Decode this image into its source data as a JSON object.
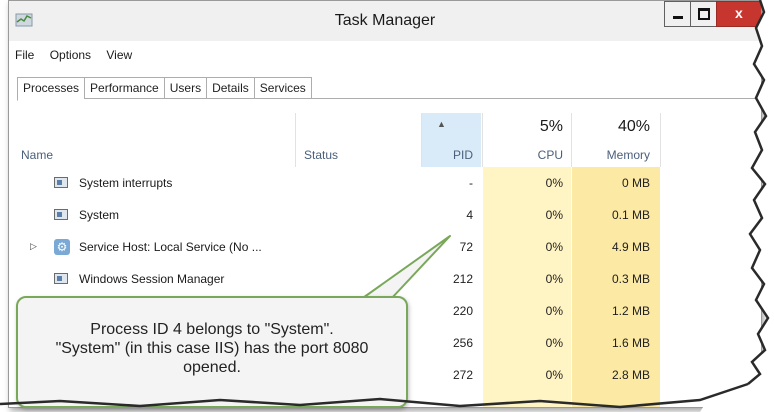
{
  "window": {
    "title": "Task Manager",
    "minimize_icon": "minimize-icon",
    "maximize_icon": "maximize-icon",
    "close_glyph": "x"
  },
  "menu": [
    "File",
    "Options",
    "View"
  ],
  "tabs": [
    "Processes",
    "Performance",
    "Users",
    "Details",
    "Services"
  ],
  "active_tab": "Processes",
  "columns": {
    "name": "Name",
    "status": "Status",
    "pid": "PID",
    "cpu": "CPU",
    "cpu_total": "5%",
    "memory": "Memory",
    "memory_total": "40%",
    "sort_indicator": "▲"
  },
  "rows": [
    {
      "name": "System interrupts",
      "status": "",
      "pid": "-",
      "cpu": "0%",
      "memory": "0 MB",
      "icon": "window-icon"
    },
    {
      "name": "System",
      "status": "",
      "pid": "4",
      "cpu": "0%",
      "memory": "0.1 MB",
      "icon": "window-icon"
    },
    {
      "name": "Service Host: Local Service (No ...",
      "status": "",
      "pid": "72",
      "cpu": "0%",
      "memory": "4.9 MB",
      "icon": "gear-icon",
      "expandable": true
    },
    {
      "name": "Windows Session Manager",
      "status": "",
      "pid": "212",
      "cpu": "0%",
      "memory": "0.3 MB",
      "icon": "window-icon"
    },
    {
      "name": "",
      "status": "",
      "pid": "220",
      "cpu": "0%",
      "memory": "1.2 MB"
    },
    {
      "name": "",
      "status": "",
      "pid": "256",
      "cpu": "0%",
      "memory": "1.6 MB"
    },
    {
      "name": "",
      "status": "",
      "pid": "272",
      "cpu": "0%",
      "memory": "2.8 MB"
    }
  ],
  "callout": {
    "line1": "Process ID 4 belongs to \"System\".",
    "line2": "\"System\" (in this case IIS) has the port 8080",
    "line3": "opened."
  },
  "colors": {
    "cpu_column": "#fff4c4",
    "memory_column": "#fbe9a4",
    "close_button": "#c7362e",
    "callout_border": "#7aa85a"
  }
}
